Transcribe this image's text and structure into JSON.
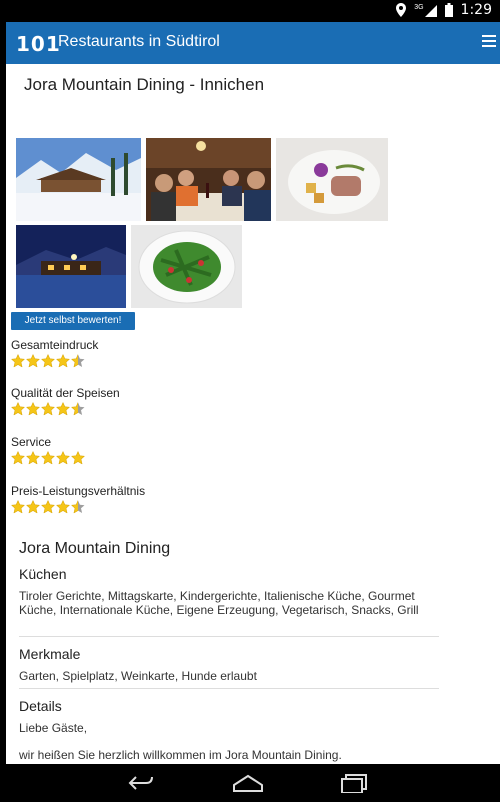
{
  "status_bar": {
    "network": "3G",
    "time": "1:29"
  },
  "app_bar": {
    "logo": "101",
    "title": "Restaurants in Südtirol"
  },
  "restaurant": {
    "title": "Jora Mountain Dining - Innichen"
  },
  "rate_button": "Jetzt selbst bewerten!",
  "ratings": [
    {
      "label": "Gesamteindruck",
      "stars": 4.5
    },
    {
      "label": "Qualität der Speisen",
      "stars": 4.5
    },
    {
      "label": "Service",
      "stars": 5
    },
    {
      "label": "Preis-Leistungsverhältnis",
      "stars": 4.5
    }
  ],
  "details": {
    "name": "Jora Mountain Dining",
    "kuechen_heading": "Küchen",
    "kuechen_text": "Tiroler Gerichte, Mittagskarte, Kindergerichte, Italienische Küche, Gourmet Küche, Internationale Küche, Eigene Erzeugung, Vegetarisch, Snacks, Grill",
    "merkmale_heading": "Merkmale",
    "merkmale_text": "Garten, Spielplatz, Weinkarte, Hunde erlaubt",
    "details_heading": "Details",
    "greeting": "Liebe Gäste,",
    "welcome": "wir heißen Sie herzlich willkommen im Jora Mountain Dining."
  },
  "colors": {
    "brand": "#1a6db4",
    "star": "#f5c518",
    "star_empty": "#9e9e9e"
  }
}
